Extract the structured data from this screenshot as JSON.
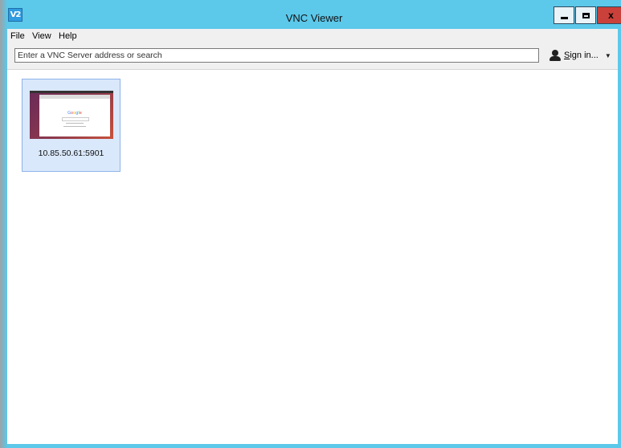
{
  "window": {
    "title": "VNC Viewer",
    "app_icon_text": "V2",
    "minimize_icon": "minimize-icon",
    "maximize_icon": "maximize-icon",
    "close_label": "x"
  },
  "menu": {
    "items": [
      "File",
      "View",
      "Help"
    ]
  },
  "toolbar": {
    "search_placeholder": "Enter a VNC Server address or search",
    "signin_underlined": "S",
    "signin_rest": "ign in...",
    "signin_dropdown": "▼"
  },
  "connections": [
    {
      "address": "10.85.50.61:5901",
      "thumbnail_text": "Google"
    }
  ],
  "colors": {
    "title_bar": "#5cc8ea",
    "close_button": "#c9413a",
    "selected_tile": "#d9e8fb"
  }
}
